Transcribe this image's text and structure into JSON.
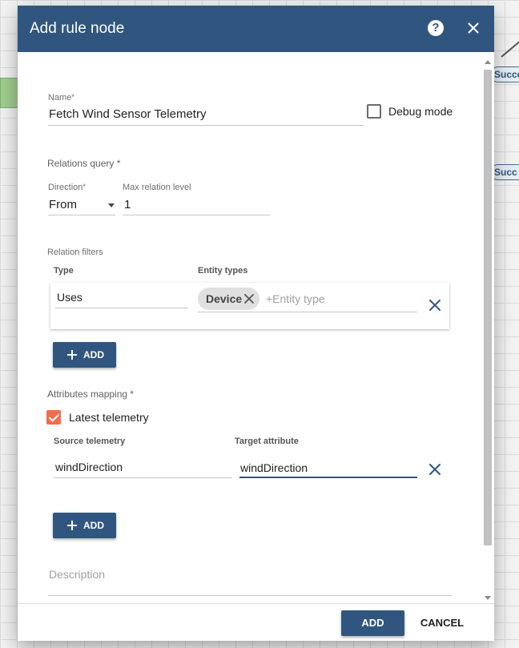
{
  "background": {
    "edge_labels": [
      "Succes",
      "Succ"
    ]
  },
  "dialog": {
    "title": "Add rule node"
  },
  "form": {
    "name": {
      "label": "Name",
      "required_mark": "*",
      "value": "Fetch Wind Sensor Telemetry"
    },
    "debug_mode": {
      "label": "Debug mode",
      "checked": false
    },
    "relations_query": {
      "label": "Relations query *"
    },
    "direction": {
      "label": "Direction",
      "required_mark": "*",
      "value": "From"
    },
    "max_relation_level": {
      "label": "Max relation level",
      "value": "1"
    },
    "relation_filters": {
      "label": "Relation filters",
      "col_type": "Type",
      "col_entity_types": "Entity types",
      "rows": [
        {
          "type": "Uses",
          "chips": [
            "Device"
          ],
          "entity_placeholder": "+Entity type"
        }
      ],
      "add_label": "ADD"
    },
    "attributes_mapping": {
      "label": "Attributes mapping *",
      "latest_telemetry": {
        "label": "Latest telemetry",
        "checked": true
      },
      "col_source": "Source telemetry",
      "col_target": "Target attribute",
      "rows": [
        {
          "source": "windDirection",
          "target": "windDirection"
        }
      ],
      "add_label": "ADD"
    },
    "description": {
      "placeholder": "Description"
    }
  },
  "footer": {
    "add_label": "ADD",
    "cancel_label": "CANCEL"
  },
  "colors": {
    "primary": "#305680",
    "accent": "#f26d4d"
  }
}
